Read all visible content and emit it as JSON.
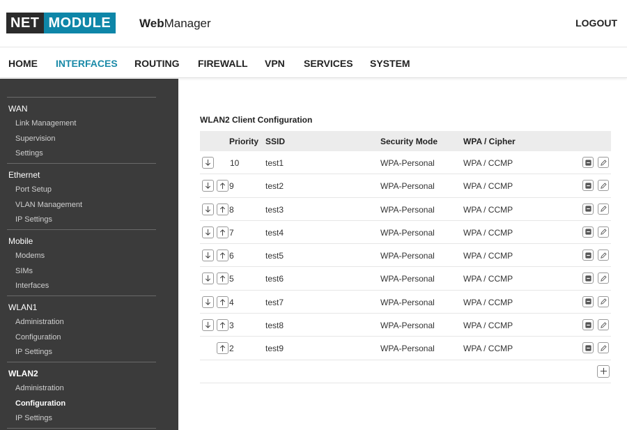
{
  "header": {
    "logo_left": "NET",
    "logo_right": "MODULE",
    "app_name_bold": "Web",
    "app_name_rest": "Manager",
    "logout": "LOGOUT"
  },
  "nav": {
    "items": [
      "HOME",
      "INTERFACES",
      "ROUTING",
      "FIREWALL",
      "VPN",
      "SERVICES",
      "SYSTEM"
    ],
    "active": "INTERFACES"
  },
  "sidebar": {
    "groups": [
      {
        "label": "WAN",
        "items": [
          "Link Management",
          "Supervision",
          "Settings"
        ]
      },
      {
        "label": "Ethernet",
        "items": [
          "Port Setup",
          "VLAN Management",
          "IP Settings"
        ]
      },
      {
        "label": "Mobile",
        "items": [
          "Modems",
          "SIMs",
          "Interfaces"
        ]
      },
      {
        "label": "WLAN1",
        "items": [
          "Administration",
          "Configuration",
          "IP Settings"
        ]
      },
      {
        "label": "WLAN2",
        "items": [
          "Administration",
          "Configuration",
          "IP Settings"
        ]
      }
    ],
    "active_group": "WLAN2",
    "active_item": "Configuration"
  },
  "content": {
    "title": "WLAN2 Client Configuration",
    "columns": {
      "priority": "Priority",
      "ssid": "SSID",
      "security": "Security Mode",
      "cipher": "WPA / Cipher"
    },
    "rows": [
      {
        "priority": "10",
        "ssid": "test1",
        "security": "WPA-Personal",
        "cipher": "WPA / CCMP",
        "down": true,
        "up": false
      },
      {
        "priority": "9",
        "ssid": "test2",
        "security": "WPA-Personal",
        "cipher": "WPA / CCMP",
        "down": true,
        "up": true
      },
      {
        "priority": "8",
        "ssid": "test3",
        "security": "WPA-Personal",
        "cipher": "WPA / CCMP",
        "down": true,
        "up": true
      },
      {
        "priority": "7",
        "ssid": "test4",
        "security": "WPA-Personal",
        "cipher": "WPA / CCMP",
        "down": true,
        "up": true
      },
      {
        "priority": "6",
        "ssid": "test5",
        "security": "WPA-Personal",
        "cipher": "WPA / CCMP",
        "down": true,
        "up": true
      },
      {
        "priority": "5",
        "ssid": "test6",
        "security": "WPA-Personal",
        "cipher": "WPA / CCMP",
        "down": true,
        "up": true
      },
      {
        "priority": "4",
        "ssid": "test7",
        "security": "WPA-Personal",
        "cipher": "WPA / CCMP",
        "down": true,
        "up": true
      },
      {
        "priority": "3",
        "ssid": "test8",
        "security": "WPA-Personal",
        "cipher": "WPA / CCMP",
        "down": true,
        "up": true
      },
      {
        "priority": "2",
        "ssid": "test9",
        "security": "WPA-Personal",
        "cipher": "WPA / CCMP",
        "down": false,
        "up": true
      }
    ]
  },
  "colors": {
    "accent": "#1a8aa8",
    "logo_dark": "#2b2b2b",
    "logo_blue": "#0e86a8",
    "sidebar_bg": "#3b3b3b"
  },
  "icons": {
    "down": "arrow-down-icon",
    "up": "arrow-up-icon",
    "delete": "minus-icon",
    "edit": "pencil-icon",
    "add": "plus-icon"
  }
}
